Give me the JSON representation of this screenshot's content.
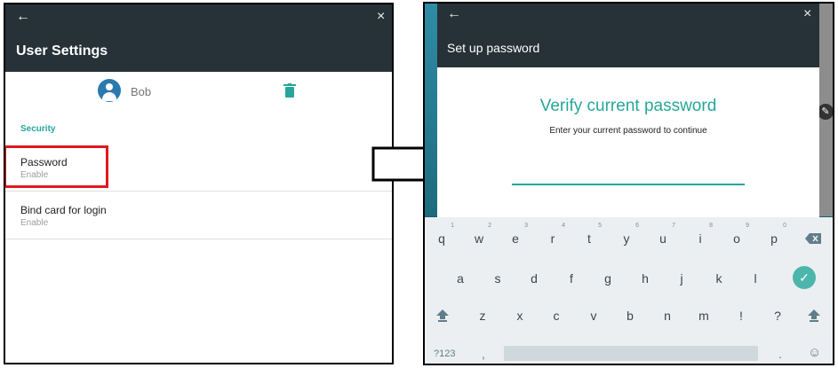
{
  "left": {
    "title": "User Settings",
    "back_icon": "←",
    "close_icon": "×",
    "user": {
      "name": "Bob"
    },
    "section_label": "Security",
    "items": [
      {
        "title": "Password",
        "status": "Enable"
      },
      {
        "title": "Bind card for login",
        "status": "Enable"
      }
    ],
    "colors": {
      "appbar": "#263238",
      "accent": "#26a69a",
      "avatar": "#2a7ab0",
      "highlight": "#e0191f"
    }
  },
  "right": {
    "title": "Set up password",
    "back_icon": "←",
    "close_icon": "×",
    "dialog": {
      "heading": "Verify current password",
      "description": "Enter your current password to continue"
    },
    "keyboard": {
      "row1": [
        {
          "key": "q",
          "hint": "1"
        },
        {
          "key": "w",
          "hint": "2"
        },
        {
          "key": "e",
          "hint": "3"
        },
        {
          "key": "r",
          "hint": "4"
        },
        {
          "key": "t",
          "hint": "5"
        },
        {
          "key": "y",
          "hint": "6"
        },
        {
          "key": "u",
          "hint": "7"
        },
        {
          "key": "i",
          "hint": "8"
        },
        {
          "key": "o",
          "hint": "9"
        },
        {
          "key": "p",
          "hint": "0"
        }
      ],
      "row2": [
        "a",
        "s",
        "d",
        "f",
        "g",
        "h",
        "j",
        "k",
        "l"
      ],
      "row3": [
        "z",
        "x",
        "c",
        "v",
        "b",
        "n",
        "m",
        "!",
        "?"
      ],
      "symbols_label": "?123",
      "comma": ",",
      "period": ".",
      "icons": {
        "backspace": "backspace-icon",
        "enter": "check-icon",
        "shift": "shift-icon",
        "emoji": "emoji-icon"
      }
    }
  }
}
